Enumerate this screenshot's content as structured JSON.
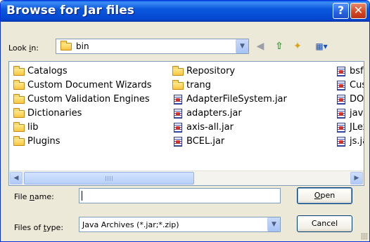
{
  "window": {
    "title": "Browse for Jar files",
    "help_glyph": "?",
    "close_glyph": "✕"
  },
  "lookin": {
    "label_prefix": "Look ",
    "label_hotkey": "i",
    "label_suffix": "n:",
    "folder_icon": "folder-icon",
    "value": "bin"
  },
  "toolbar": {
    "back_icon": "back-arrow-icon",
    "up_icon": "up-folder-icon",
    "new_icon": "new-folder-icon",
    "view_icon": "view-menu-icon"
  },
  "files": {
    "columns": [
      [
        {
          "type": "folder",
          "name": "Catalogs"
        },
        {
          "type": "folder",
          "name": "Custom Document Wizards"
        },
        {
          "type": "folder",
          "name": "Custom Validation Engines"
        },
        {
          "type": "folder",
          "name": "Dictionaries"
        },
        {
          "type": "folder",
          "name": "lib"
        },
        {
          "type": "folder",
          "name": "Plugins"
        }
      ],
      [
        {
          "type": "folder",
          "name": "Repository"
        },
        {
          "type": "folder",
          "name": "trang"
        },
        {
          "type": "jar",
          "name": "AdapterFileSystem.jar"
        },
        {
          "type": "jar",
          "name": "adapters.jar"
        },
        {
          "type": "jar",
          "name": "axis-all.jar"
        },
        {
          "type": "jar",
          "name": "BCEL.jar"
        }
      ],
      [
        {
          "type": "jar",
          "name": "bsf."
        },
        {
          "type": "jar",
          "name": "Cust"
        },
        {
          "type": "jar",
          "name": "DOM"
        },
        {
          "type": "jar",
          "name": "java"
        },
        {
          "type": "jar",
          "name": "JLex"
        },
        {
          "type": "jar",
          "name": "js.ja"
        }
      ]
    ]
  },
  "filename": {
    "label_prefix": "File ",
    "label_hotkey": "n",
    "label_suffix": "ame:",
    "value": ""
  },
  "filetype": {
    "label_prefix": "Files of ",
    "label_hotkey": "t",
    "label_suffix": "ype:",
    "value": "Java Archives (*.jar;*.zip)"
  },
  "buttons": {
    "open_hotkey": "O",
    "open_rest": "pen",
    "cancel": "Cancel"
  },
  "colors": {
    "titlebar": "#0a58dd",
    "dialog_bg": "#ece9d8",
    "accent_border": "#7f9db9"
  }
}
